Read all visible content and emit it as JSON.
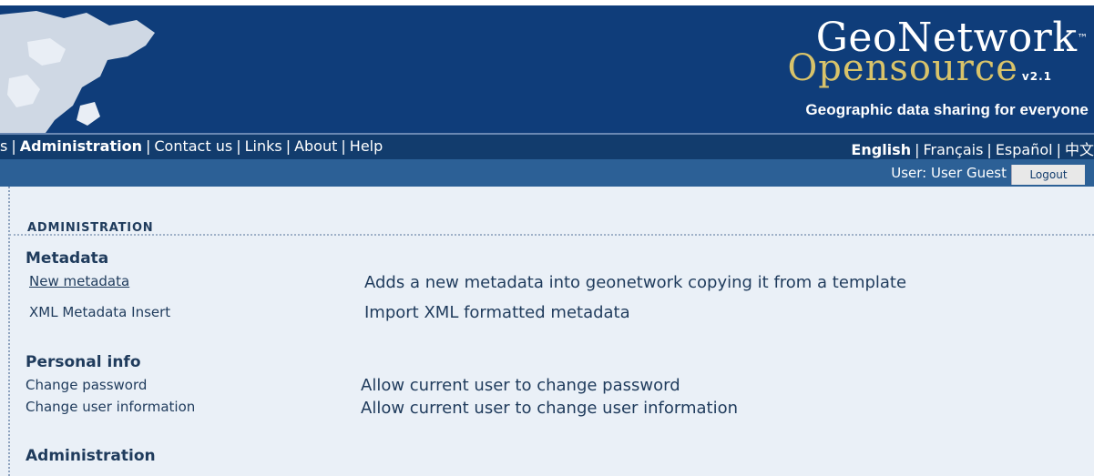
{
  "brand": {
    "name": "GeoNetwork",
    "tm": "™",
    "sub": "Opensource",
    "version": "v2.1",
    "tagline": "Geographic data sharing for everyone"
  },
  "nav": {
    "left_items": [
      "s",
      "Administration",
      "Contact us",
      "Links",
      "About",
      "Help"
    ],
    "right_items": [
      "English",
      "Français",
      "Español",
      "中文"
    ]
  },
  "user": {
    "label": "User: User Guest",
    "logout_label": "Logout"
  },
  "page": {
    "heading": "ADMINISTRATION"
  },
  "sections": [
    {
      "title": "Metadata",
      "rows": [
        {
          "link": "New metadata",
          "desc": "Adds a new metadata into geonetwork copying it from a template"
        },
        {
          "link": "XML Metadata Insert",
          "desc": "Import XML formatted metadata"
        }
      ]
    },
    {
      "title": "Personal info",
      "rows": [
        {
          "link": "Change password",
          "desc": "Allow current user to change password"
        },
        {
          "link": "Change user information",
          "desc": "Allow current user to change user information"
        }
      ]
    },
    {
      "title": "Administration",
      "rows": []
    }
  ],
  "colors": {
    "banner": "#0f3d7a",
    "navbar": "#123c6d",
    "userbar": "#2c6096",
    "content_bg": "#eaf0f7",
    "text": "#1f3b5c",
    "brand_accent": "#d8c36a"
  }
}
